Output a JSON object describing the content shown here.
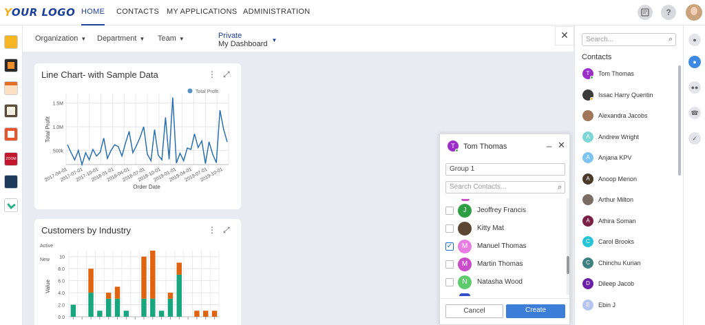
{
  "header": {
    "logo": "YOUR LOGO",
    "nav": [
      "HOME",
      "CONTACTS",
      "MY APPLICATIONS",
      "ADMINISTRATION"
    ],
    "active_nav": "HOME"
  },
  "filters": {
    "organization": "Organization",
    "department": "Department",
    "team": "Team",
    "private": "Private",
    "dashboard": "My Dashboard"
  },
  "line_widget": {
    "title": "Line Chart- with Sample Data",
    "chart_data": {
      "type": "line",
      "legend": "Total Profit",
      "legend_position": "top-right",
      "xlabel": "Order Date",
      "ylabel": "Total Profit",
      "yticks": [
        "500k",
        "1.0M",
        "1.5M"
      ],
      "xticks": [
        "2017-04-01",
        "2017-07-01",
        "2017-10-01",
        "2018-01-01",
        "2018-04-01",
        "2018-07-01",
        "2018-10-01",
        "2019-01-01",
        "2019-04-01",
        "2019-07-01",
        "2019-10-01"
      ],
      "ylim": [
        200000,
        1700000
      ],
      "grid": true,
      "values": [
        620000,
        450000,
        300000,
        500000,
        200000,
        450000,
        300000,
        520000,
        380000,
        460000,
        760000,
        330000,
        500000,
        620000,
        580000,
        380000,
        660000,
        900000,
        450000,
        600000,
        780000,
        1000000,
        420000,
        280000,
        940000,
        400000,
        300000,
        1200000,
        310000,
        1620000,
        230000,
        440000,
        280000,
        550000,
        520000,
        850000,
        560000,
        700000,
        220000,
        680000,
        420000,
        240000,
        1350000,
        950000,
        680000
      ],
      "color": "#2a6fb0"
    }
  },
  "bar_widget": {
    "title": "Customers by Industry",
    "chart_data": {
      "type": "bar",
      "stacked": true,
      "legend": [
        "Active",
        "New"
      ],
      "legend_position": "top-left",
      "ylabel": "Value",
      "yticks": [
        "0.0",
        "2.0",
        "4.0",
        "6.0",
        "8.0",
        "10"
      ],
      "ylim": [
        0,
        11
      ],
      "grid": true,
      "series": [
        {
          "name": "Active",
          "color": "#17a67e",
          "values": [
            2,
            0,
            4,
            1,
            3,
            3,
            1,
            0,
            3,
            3,
            1,
            3,
            7,
            0,
            0,
            0,
            0
          ]
        },
        {
          "name": "New",
          "color": "#e0640f",
          "values": [
            0,
            0,
            4,
            0,
            1,
            2,
            0,
            0,
            7,
            8,
            0,
            1,
            2,
            0,
            1,
            1,
            1
          ]
        }
      ]
    }
  },
  "chat": {
    "user": "Tom Thomas",
    "user_initial": "T",
    "group": "Group 1",
    "search_placeholder": "Search Contacts...",
    "contacts": [
      {
        "name": "Jeoffrey Francis",
        "initial": "J",
        "color": "#2e9e45",
        "checked": false
      },
      {
        "name": "Kitty Mat",
        "initial": "",
        "color": "#5a4632",
        "checked": false
      },
      {
        "name": "Manuel Thomas",
        "initial": "M",
        "color": "#e67de0",
        "checked": true
      },
      {
        "name": "Martin Thomas",
        "initial": "M",
        "color": "#c94cc9",
        "checked": false
      },
      {
        "name": "Natasha Wood",
        "initial": "N",
        "color": "#5fca6e",
        "checked": false
      }
    ],
    "cancel": "Cancel",
    "create": "Create"
  },
  "contacts_panel": {
    "search_placeholder": "Search...",
    "title": "Contacts",
    "people": [
      {
        "name": "Tom Thomas",
        "initial": "T",
        "color": "#9b2fc8",
        "status": "online"
      },
      {
        "name": "Issac Harry Quentin",
        "initial": "",
        "color": "#3b3b3b",
        "status": "away"
      },
      {
        "name": "Alexandra Jacobs",
        "initial": "",
        "color": "#a07658",
        "status": ""
      },
      {
        "name": "Andrew Wright",
        "initial": "A",
        "color": "#7ed6d6",
        "status": ""
      },
      {
        "name": "Anjana KPV",
        "initial": "A",
        "color": "#7ec4f0",
        "status": ""
      },
      {
        "name": "Anoop Menon",
        "initial": "A",
        "color": "#4a3a2a",
        "status": ""
      },
      {
        "name": "Arthur Milton",
        "initial": "",
        "color": "#7a6e64",
        "status": ""
      },
      {
        "name": "Athira Soman",
        "initial": "A",
        "color": "#7a2046",
        "status": ""
      },
      {
        "name": "Carol Brooks",
        "initial": "C",
        "color": "#29c4d8",
        "status": ""
      },
      {
        "name": "Chinchu Kurian",
        "initial": "C",
        "color": "#3f8181",
        "status": ""
      },
      {
        "name": "Dileep Jacob",
        "initial": "D",
        "color": "#6a1fa8",
        "status": ""
      },
      {
        "name": "Ebin J",
        "initial": "E",
        "color": "#b6c4f0",
        "status": ""
      }
    ]
  },
  "icons": {
    "left_rail": [
      "app-yellow-icon",
      "app-orange-icon",
      "calendar-icon",
      "notes-icon",
      "forms-icon",
      "zoom-icon",
      "integration-icon",
      "edit-icon"
    ],
    "right_rail": [
      "chat-icon",
      "profile-icon",
      "group-icon",
      "phone-icon",
      "calendar-check-icon"
    ],
    "top": [
      "notification-icon",
      "help-icon",
      "user-avatar"
    ]
  }
}
